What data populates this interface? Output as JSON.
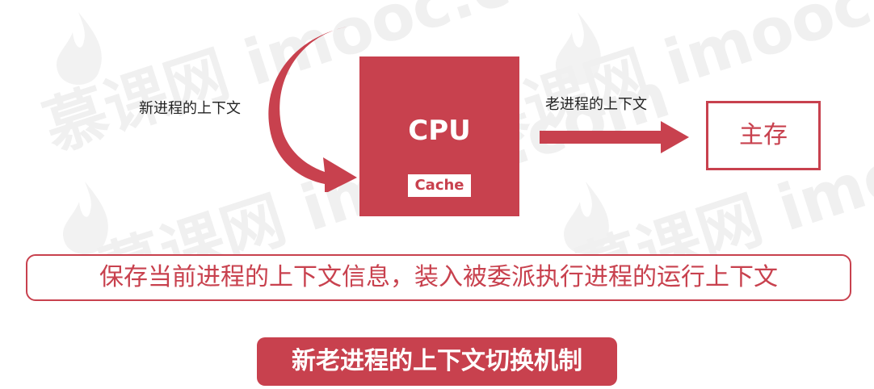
{
  "watermark": {
    "cn": "慕课网",
    "en": "imooc.com"
  },
  "diagram": {
    "new_context_label": "新进程的上下文",
    "old_context_label": "老进程的上下文",
    "cpu_label": "CPU",
    "cache_label": "Cache",
    "memory_label": "主存"
  },
  "description": "保存当前进程的上下文信息，装入被委派执行进程的运行上下文",
  "caption": "新老进程的上下文切换机制",
  "colors": {
    "accent": "#c8414e",
    "text": "#222222",
    "watermark": "#f0f0f0"
  }
}
